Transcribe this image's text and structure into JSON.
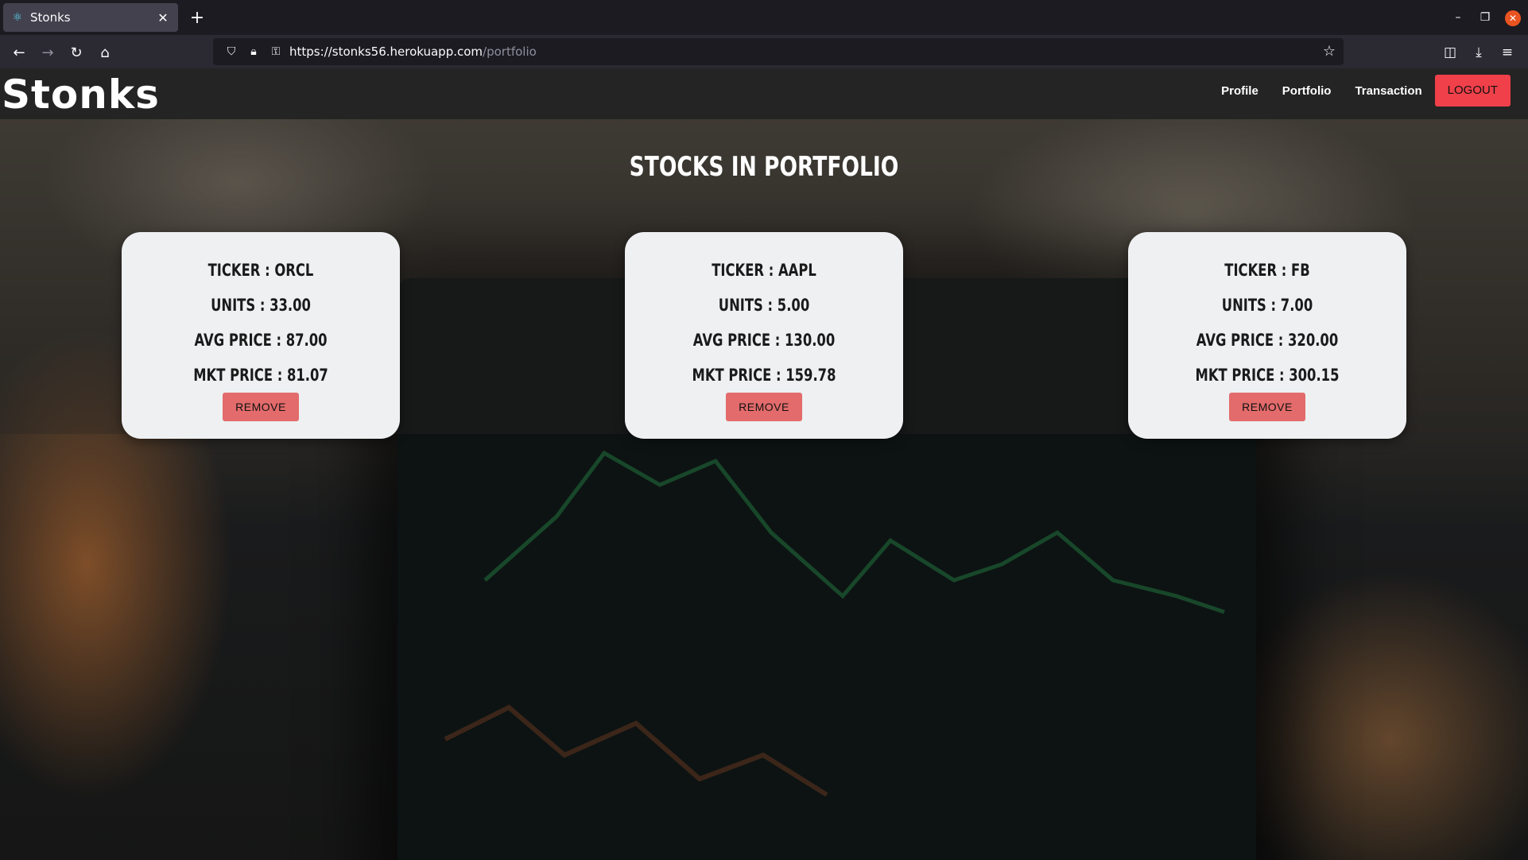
{
  "browser": {
    "tab_title": "Stonks",
    "url_host": "https://stonks56.herokuapp.com",
    "url_path": "/portfolio"
  },
  "app": {
    "brand": "Stonks",
    "nav": {
      "profile": "Profile",
      "portfolio": "Portfolio",
      "transaction": "Transaction",
      "logout": "LOGOUT"
    },
    "heading": "STOCKS IN PORTFOLIO",
    "cards": [
      {
        "ticker": "TICKER : ORCL",
        "units": "UNITS : 33.00",
        "avg": "AVG PRICE : 87.00",
        "mkt": "MKT PRICE : 81.07",
        "remove": "REMOVE"
      },
      {
        "ticker": "TICKER : AAPL",
        "units": "UNITS : 5.00",
        "avg": "AVG PRICE : 130.00",
        "mkt": "MKT PRICE : 159.78",
        "remove": "REMOVE"
      },
      {
        "ticker": "TICKER : FB",
        "units": "UNITS : 7.00",
        "avg": "AVG PRICE : 320.00",
        "mkt": "MKT PRICE : 300.15",
        "remove": "REMOVE"
      }
    ]
  },
  "colors": {
    "logout_bg": "#f0404a",
    "remove_bg": "#e36b6b",
    "card_bg": "#eef0f2",
    "header_bg": "#242424"
  }
}
